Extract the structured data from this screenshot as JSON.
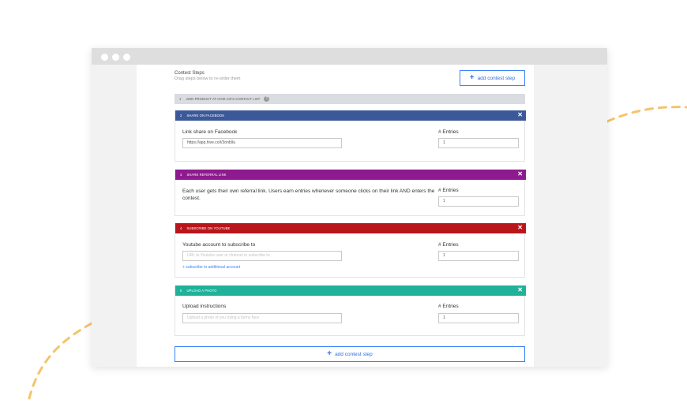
{
  "window": {
    "title_dots": [
      "dot",
      "dot",
      "dot"
    ]
  },
  "header": {
    "title": "Contest Steps",
    "subtitle": "Drag steps below to re-order them",
    "add_button": "add contest step"
  },
  "steps": [
    {
      "num": "1",
      "title": "JOIN PRODUCT AT HIVE CO'S CONTACT LIST",
      "help": "?"
    },
    {
      "num": "2",
      "title": "SHARE ON FACEBOOK",
      "color": "#3b5998",
      "field_label": "Link share on Facebook",
      "field_value": "https://app.hive.co/l/3onb9u",
      "entries_label": "# Entries",
      "entries_value": "1"
    },
    {
      "num": "3",
      "title": "SHARE REFERRAL LINK",
      "color": "#8e1a8f",
      "description": "Each user gets their own referral link. Users earn entries whenever someone clicks on their link AND enters the contest.",
      "entries_label": "# Entries",
      "entries_value": "1"
    },
    {
      "num": "4",
      "title": "SUBSCRIBE ON YOUTUBE",
      "color": "#b8161b",
      "field_label": "Youtube account to subscribe to",
      "field_placeholder": "URL to Youtube user or channel to subscribe to",
      "extra_link": "+ subscribe to additional account",
      "entries_label": "# Entries",
      "entries_value": "1"
    },
    {
      "num": "5",
      "title": "UPLOAD A PHOTO",
      "color": "#1fb19a",
      "field_label": "Upload instructions",
      "field_placeholder": "Upload a photo of you trying a funny face",
      "entries_label": "# Entries",
      "entries_value": "1"
    }
  ],
  "footer": {
    "add_button": "add contest step"
  },
  "icons": {
    "plus": "plus-icon",
    "close": "close-icon",
    "help": "help-icon"
  },
  "colors": {
    "accent": "#3b82f6",
    "decoration": "#f5c46a"
  }
}
